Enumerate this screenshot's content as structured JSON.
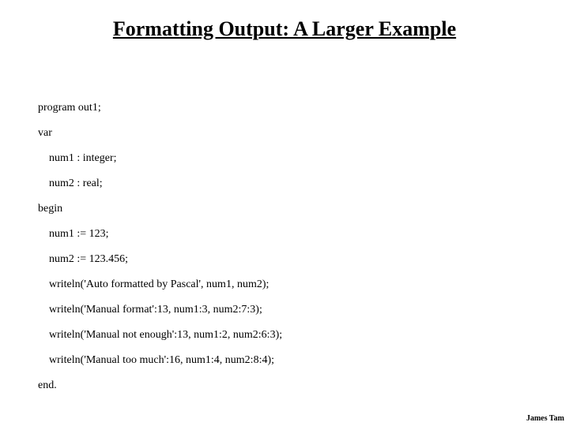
{
  "title": "Formatting Output: A Larger Example",
  "code": {
    "l1": "program out1;",
    "l2": "var",
    "l3": "num1 : integer;",
    "l4": "num2 : real;",
    "l5": "begin",
    "l6": "num1 := 123;",
    "l7": "num2 := 123.456;",
    "l8": "writeln('Auto formatted by Pascal', num1, num2);",
    "l9": "writeln('Manual format':13, num1:3, num2:7:3);",
    "l10": "writeln('Manual not enough':13, num1:2, num2:6:3);",
    "l11": "writeln('Manual too much':16, num1:4, num2:8:4);",
    "l12": "end."
  },
  "footer": "James Tam"
}
